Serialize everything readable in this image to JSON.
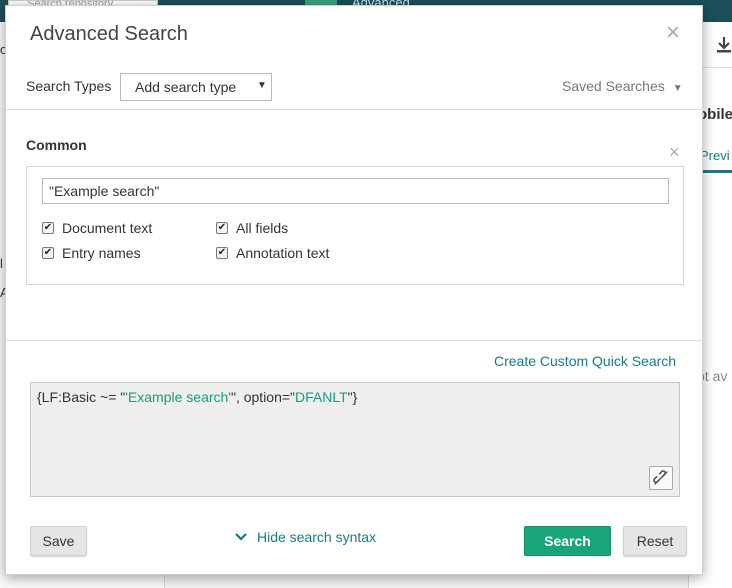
{
  "background": {
    "search_placeholder": "Search repository",
    "topbar_text": "Advanced",
    "filename_fragment": "obilet",
    "preview_tab": "Previ",
    "not_available": "ot av",
    "left_marker_1": "o",
    "left_marker_2": "l",
    "left_marker_3": "A"
  },
  "modal": {
    "title": "Advanced Search",
    "close_glyph": "×",
    "search_types_label": "Search Types",
    "add_search_type": "Add search type",
    "saved_searches": "Saved Searches",
    "common": {
      "title": "Common",
      "close_glyph": "×",
      "search_value": "\"Example search\"",
      "checkboxes": [
        {
          "label": "Document text",
          "checked": true
        },
        {
          "label": "All fields",
          "checked": true
        },
        {
          "label": "Entry names",
          "checked": true
        },
        {
          "label": "Annotation text",
          "checked": true
        }
      ]
    },
    "create_custom_quick_search": "Create Custom Quick Search",
    "syntax": {
      "prefix": "{LF:Basic ~= \"",
      "term": "'Example search'",
      "middle": "\", option=\"",
      "option": "DFANLT",
      "suffix": "\"}"
    },
    "buttons": {
      "save": "Save",
      "hide_syntax": "Hide search syntax",
      "search": "Search",
      "reset": "Reset"
    }
  },
  "colors": {
    "accent": "#1a7a82",
    "primary_button": "#18a57c",
    "syntax_highlight": "#1a9a7e"
  }
}
